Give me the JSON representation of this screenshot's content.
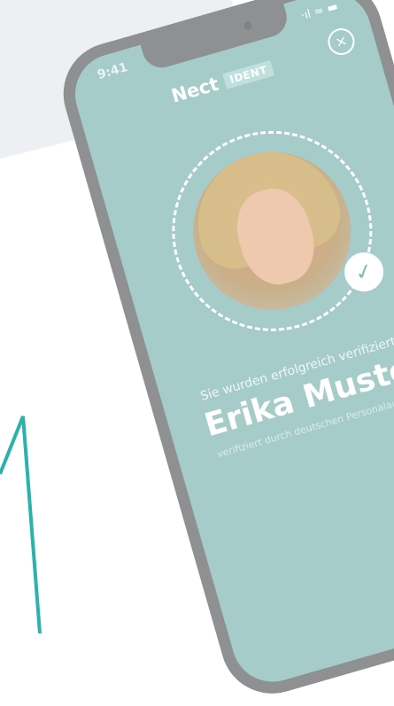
{
  "status_bar": {
    "time": "9:41",
    "icons": "·ıl ≈ ▬"
  },
  "brand": {
    "name": "Nect",
    "badge": "IDENT"
  },
  "close": {
    "glyph": "×"
  },
  "verification": {
    "status": "Sie wurden erfolgreich verifiziert",
    "name": "Erika Musterfrau",
    "source": "verifiziert durch deutschen Personalausweis"
  },
  "check_glyph": "✓",
  "colors": {
    "screen": "#a6ccca",
    "frame": "#8e9092",
    "accent": "#2bb3ab"
  }
}
